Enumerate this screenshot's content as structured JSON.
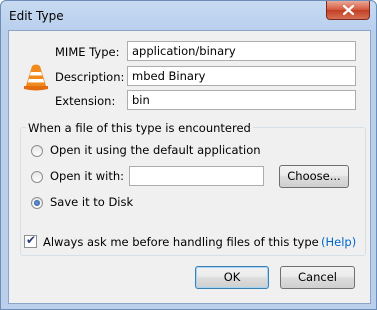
{
  "window": {
    "title": "Edit Type"
  },
  "fields": {
    "mime_label": "MIME Type:",
    "mime_value": "application/binary",
    "description_label": "Description:",
    "description_value": "mbed Binary",
    "extension_label": "Extension:",
    "extension_value": "bin"
  },
  "group": {
    "title": "When a file of this type is encountered",
    "option_default": "Open it using the default application",
    "option_with": "Open it with:",
    "option_with_value": "",
    "choose_button": "Choose...",
    "option_save": "Save it to Disk",
    "selected": "save"
  },
  "ask_checkbox": {
    "label": "Always ask me before handling files of this type",
    "checked": true
  },
  "help_link": "(Help)",
  "buttons": {
    "ok": "OK",
    "cancel": "Cancel"
  },
  "icons": {
    "app": "vlc-cone-icon",
    "close": "close-icon"
  }
}
